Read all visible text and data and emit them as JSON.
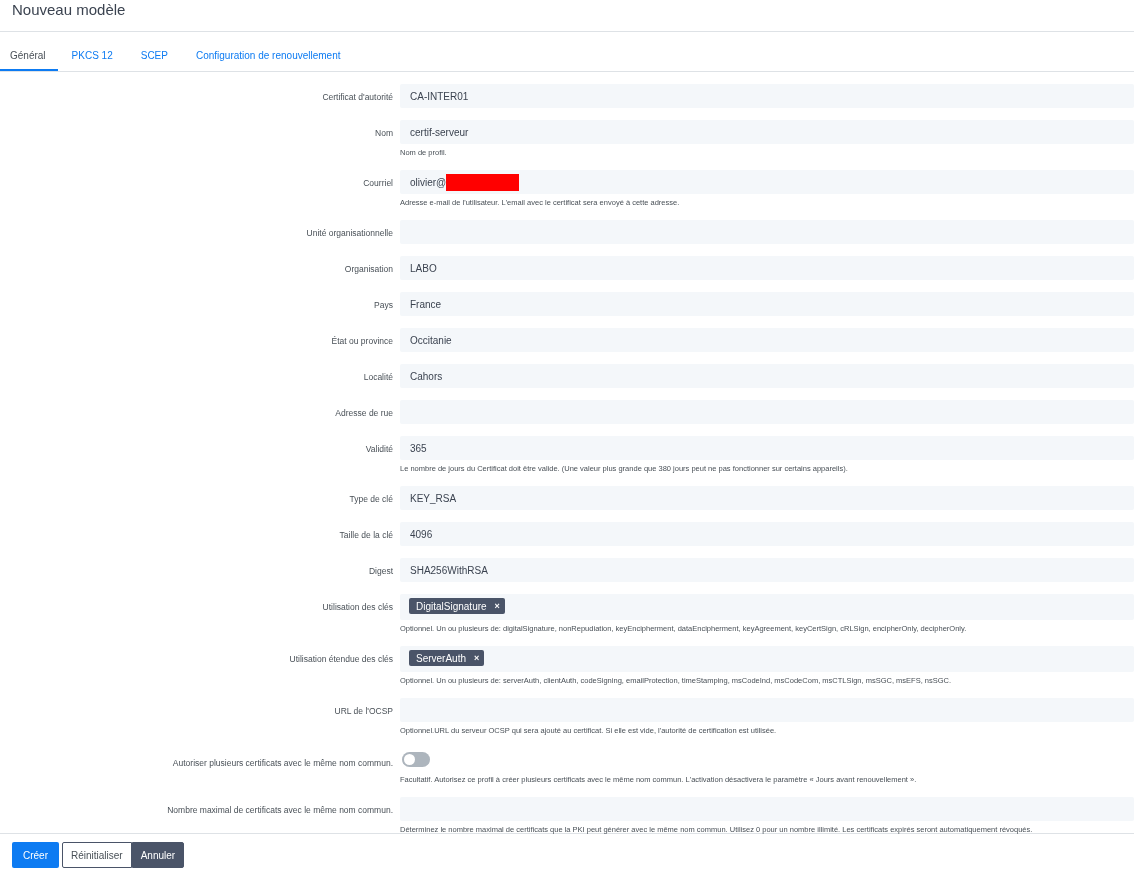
{
  "title": "Nouveau modèle",
  "tabs": [
    {
      "label": "Général",
      "selected": true
    },
    {
      "label": "PKCS 12",
      "selected": false
    },
    {
      "label": "SCEP",
      "selected": false
    },
    {
      "label": "Configuration de renouvellement",
      "selected": false
    }
  ],
  "fields": [
    {
      "kind": "text",
      "label": "Certificat d'autorité",
      "value": "CA-INTER01"
    },
    {
      "kind": "text",
      "label": "Nom",
      "value": "certif-serveur",
      "help": "Nom de profil."
    },
    {
      "kind": "text",
      "label": "Courriel",
      "value": "olivier@",
      "redacted": true,
      "help": "Adresse e-mail de l'utilisateur. L'email avec le certificat sera envoyé à cette adresse."
    },
    {
      "kind": "text",
      "label": "Unité organisationnelle"
    },
    {
      "kind": "text",
      "label": "Organisation",
      "value": "LABO"
    },
    {
      "kind": "text",
      "label": "Pays",
      "value": "France"
    },
    {
      "kind": "text",
      "label": "État ou province",
      "value": "Occitanie"
    },
    {
      "kind": "text",
      "label": "Localité",
      "value": "Cahors"
    },
    {
      "kind": "text",
      "label": "Adresse de rue"
    },
    {
      "kind": "text",
      "label": "Validité",
      "value": "365",
      "help": "Le nombre de jours du Certificat doit être valide. (Une valeur plus grande que 380 jours peut ne pas fonctionner sur certains appareils)."
    },
    {
      "kind": "text",
      "label": "Type de clé",
      "value": "KEY_RSA"
    },
    {
      "kind": "text",
      "label": "Taille de la clé",
      "value": "4096"
    },
    {
      "kind": "text",
      "label": "Digest",
      "value": "SHA256WithRSA"
    },
    {
      "kind": "tags",
      "label": "Utilisation des clés",
      "tags": [
        {
          "text": "DigitalSignature",
          "remove": "×"
        }
      ],
      "help": "Optionnel. Un ou plusieurs de: digitalSignature, nonRepudiation, keyEncipherment, dataEncipherment, keyAgreement, keyCertSign, cRLSign, encipherOnly, decipherOnly."
    },
    {
      "kind": "tags",
      "label": "Utilisation étendue des clés",
      "tags": [
        {
          "text": "ServerAuth",
          "remove": "×"
        }
      ],
      "help": "Optionnel. Un ou plusieurs de: serverAuth, clientAuth, codeSigning, emailProtection, timeStamping, msCodeInd, msCodeCom, msCTLSign, msSGC, msEFS, nsSGC."
    },
    {
      "kind": "text",
      "label": "URL de l'OCSP",
      "help": "Optionnel.URL du serveur OCSP qui sera ajouté au certificat. Si elle est vide, l'autorité de certification est utilisée."
    },
    {
      "kind": "toggle",
      "label": "Autoriser plusieurs certificats avec le même nom commun.",
      "on": false,
      "help": "Facultatif. Autorisez ce profil à créer plusieurs certificats avec le même nom commun. L'activation désactivera le paramètre « Jours avant renouvellement »."
    },
    {
      "kind": "text",
      "label": "Nombre maximal de certificats avec le même nom commun.",
      "help": "Déterminez le nombre maximal de certificats que la PKI peut générer avec le même nom commun. Utilisez 0 pour un nombre illimité. Les certificats expirés seront automatiquement révoqués."
    }
  ],
  "buttons": [
    {
      "label": "Créer",
      "kind": "primary"
    },
    {
      "label": "Réinitialiser",
      "kind": "outline"
    },
    {
      "label": "Annuler",
      "kind": "dark"
    }
  ]
}
